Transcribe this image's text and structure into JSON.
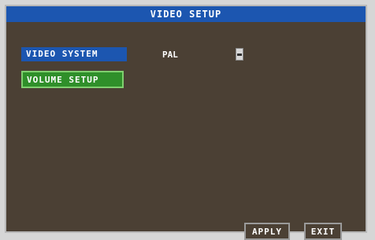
{
  "window": {
    "title": "VIDEO SETUP"
  },
  "video_system": {
    "label": "VIDEO SYSTEM",
    "value": "PAL",
    "dropdown_icon": "chevron-down-icon"
  },
  "buttons": {
    "volume_setup": "VOLUME SETUP",
    "apply": "APPLY",
    "exit": "EXIT"
  },
  "colors": {
    "panel_bg": "#4b4034",
    "accent_blue": "#1c56b0",
    "highlight_green": "#2f8f2a",
    "text": "#ffffff"
  }
}
